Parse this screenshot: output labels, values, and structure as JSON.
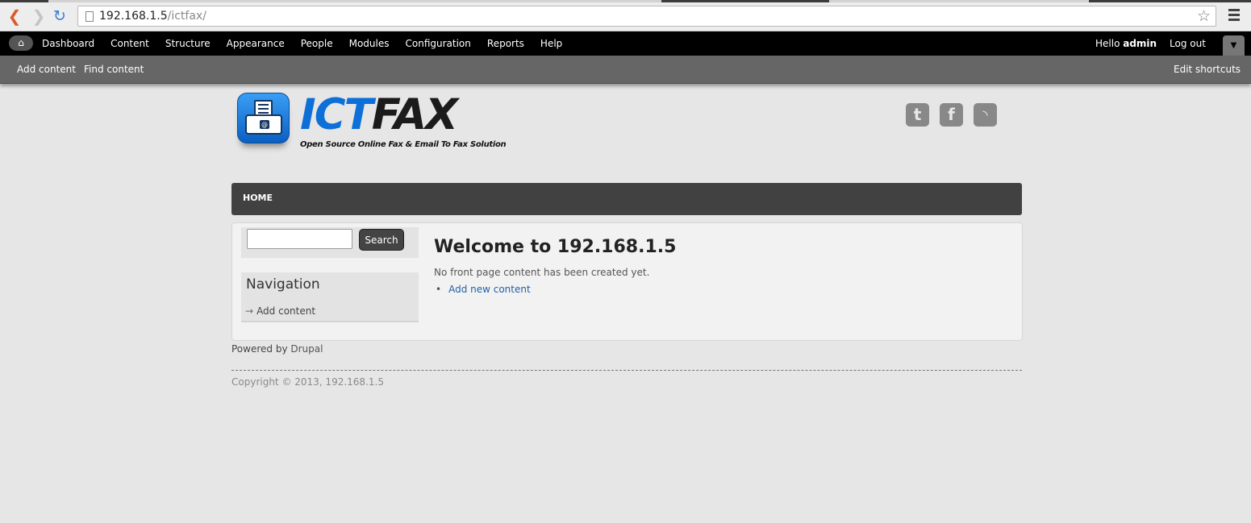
{
  "browser": {
    "url_host": "192.168.1.5",
    "url_path": "/ictfax/"
  },
  "admin_toolbar": {
    "items": [
      "Dashboard",
      "Content",
      "Structure",
      "Appearance",
      "People",
      "Modules",
      "Configuration",
      "Reports",
      "Help"
    ],
    "hello_prefix": "Hello ",
    "username": "admin",
    "logout": "Log out"
  },
  "shortcuts": {
    "add_content": "Add content",
    "find_content": "Find content",
    "edit_shortcuts": "Edit shortcuts"
  },
  "site": {
    "logo_part1": "ICT",
    "logo_part2": "FAX",
    "tagline": "Open Source Online Fax & Email To Fax Solution",
    "social_icons": [
      "twitter-icon",
      "facebook-icon",
      "rss-icon"
    ]
  },
  "main_nav": {
    "home": "HOME"
  },
  "sidebar": {
    "search_button": "Search",
    "search_value": "",
    "navigation_title": "Navigation",
    "navigation_link": "Add content"
  },
  "main": {
    "title": "Welcome to 192.168.1.5",
    "message": "No front page content has been created yet.",
    "add_link": "Add new content"
  },
  "footer": {
    "powered_prefix": "Powered by ",
    "powered_link": "Drupal",
    "copyright": "Copyright © 2013, 192.168.1.5"
  },
  "colors": {
    "admin_bar": "#000000",
    "shortcut_bar": "#666666",
    "logo_blue": "#0d6fd8",
    "link_blue": "#1f62a8",
    "nav_bar": "#414141"
  }
}
